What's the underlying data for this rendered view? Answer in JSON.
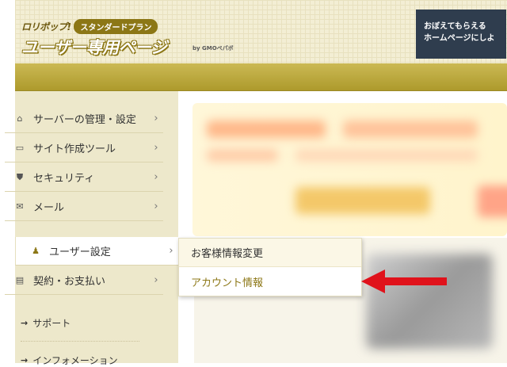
{
  "header": {
    "logo_text": "ロリポップ!",
    "plan_badge": "スタンダードプラン",
    "title": "ユーザー専用ページ",
    "by_text": "by GMOペパボ",
    "banner_lines": [
      "おぼえてもらえる",
      "ホームページにしよ"
    ]
  },
  "sidebar": {
    "items": [
      {
        "label": "サーバーの管理・設定",
        "icon": "server-icon",
        "glyph": "⌂"
      },
      {
        "label": "サイト作成ツール",
        "icon": "laptop-icon",
        "glyph": "▭"
      },
      {
        "label": "セキュリティ",
        "icon": "shield-icon",
        "glyph": "⛊"
      },
      {
        "label": "メール",
        "icon": "mail-icon",
        "glyph": "✉"
      },
      {
        "label": "ユーザー設定",
        "icon": "user-icon",
        "glyph": "♟"
      },
      {
        "label": "契約・お支払い",
        "icon": "card-icon",
        "glyph": "▤"
      }
    ],
    "arrow": "›",
    "sub_links": [
      {
        "label": "サポート"
      },
      {
        "label": "インフォメーション"
      }
    ],
    "sub_arrow": "→"
  },
  "flyout": {
    "items": [
      {
        "label": "お客様情報変更"
      },
      {
        "label": "アカウント情報"
      }
    ]
  },
  "colors": {
    "gold": "#b3a033",
    "accent": "#8c7716",
    "sidebar_bg": "#ede8cb",
    "arrow_red": "#e0121b"
  }
}
